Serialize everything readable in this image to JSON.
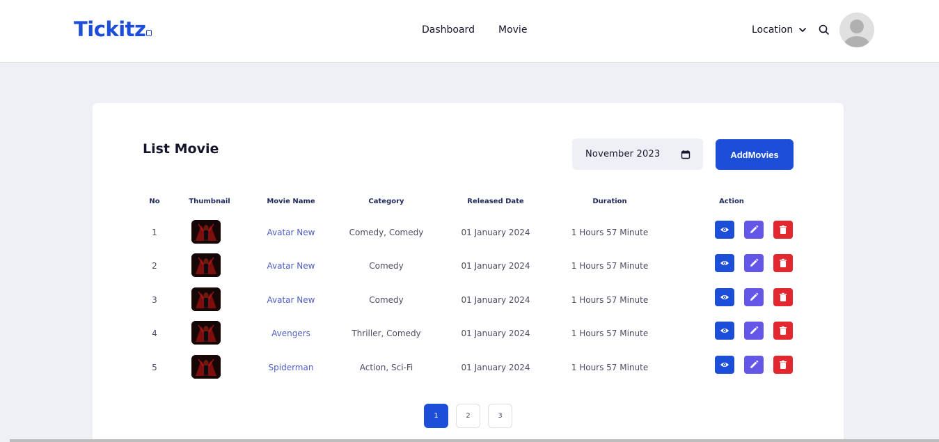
{
  "header": {
    "logo": "Tickitz",
    "nav": [
      "Dashboard",
      "Movie"
    ],
    "location_label": "Location",
    "brand_color": "#1d4ed8"
  },
  "main": {
    "title": "List Movie",
    "date_value": "November  2023",
    "add_button": "AddMovies",
    "columns": [
      "No",
      "Thumbnail",
      "Movie Name",
      "Category",
      "Released Date",
      "Duration",
      "Action"
    ],
    "rows": [
      {
        "no": "1",
        "name": "Avatar New",
        "category": "Comedy, Comedy",
        "released": "01 January 2024",
        "duration": "1 Hours 57 Minute"
      },
      {
        "no": "2",
        "name": "Avatar New",
        "category": "Comedy",
        "released": "01 January 2024",
        "duration": "1 Hours 57 Minute"
      },
      {
        "no": "3",
        "name": "Avatar New",
        "category": "Comedy",
        "released": "01 January 2024",
        "duration": "1 Hours 57 Minute"
      },
      {
        "no": "4",
        "name": "Avengers",
        "category": "Thriller, Comedy",
        "released": "01 January 2024",
        "duration": "1 Hours 57 Minute"
      },
      {
        "no": "5",
        "name": "Spiderman",
        "category": "Action, Sci-Fi",
        "released": "01 January 2024",
        "duration": "1 Hours 57 Minute"
      }
    ],
    "action_icons": [
      "eye-icon",
      "pencil-icon",
      "trash-icon"
    ],
    "action_colors": {
      "view": "#1d4ed8",
      "edit": "#6457e8",
      "delete": "#e3272e"
    }
  },
  "pagination": {
    "pages": [
      "1",
      "2",
      "3"
    ],
    "current": "1"
  }
}
